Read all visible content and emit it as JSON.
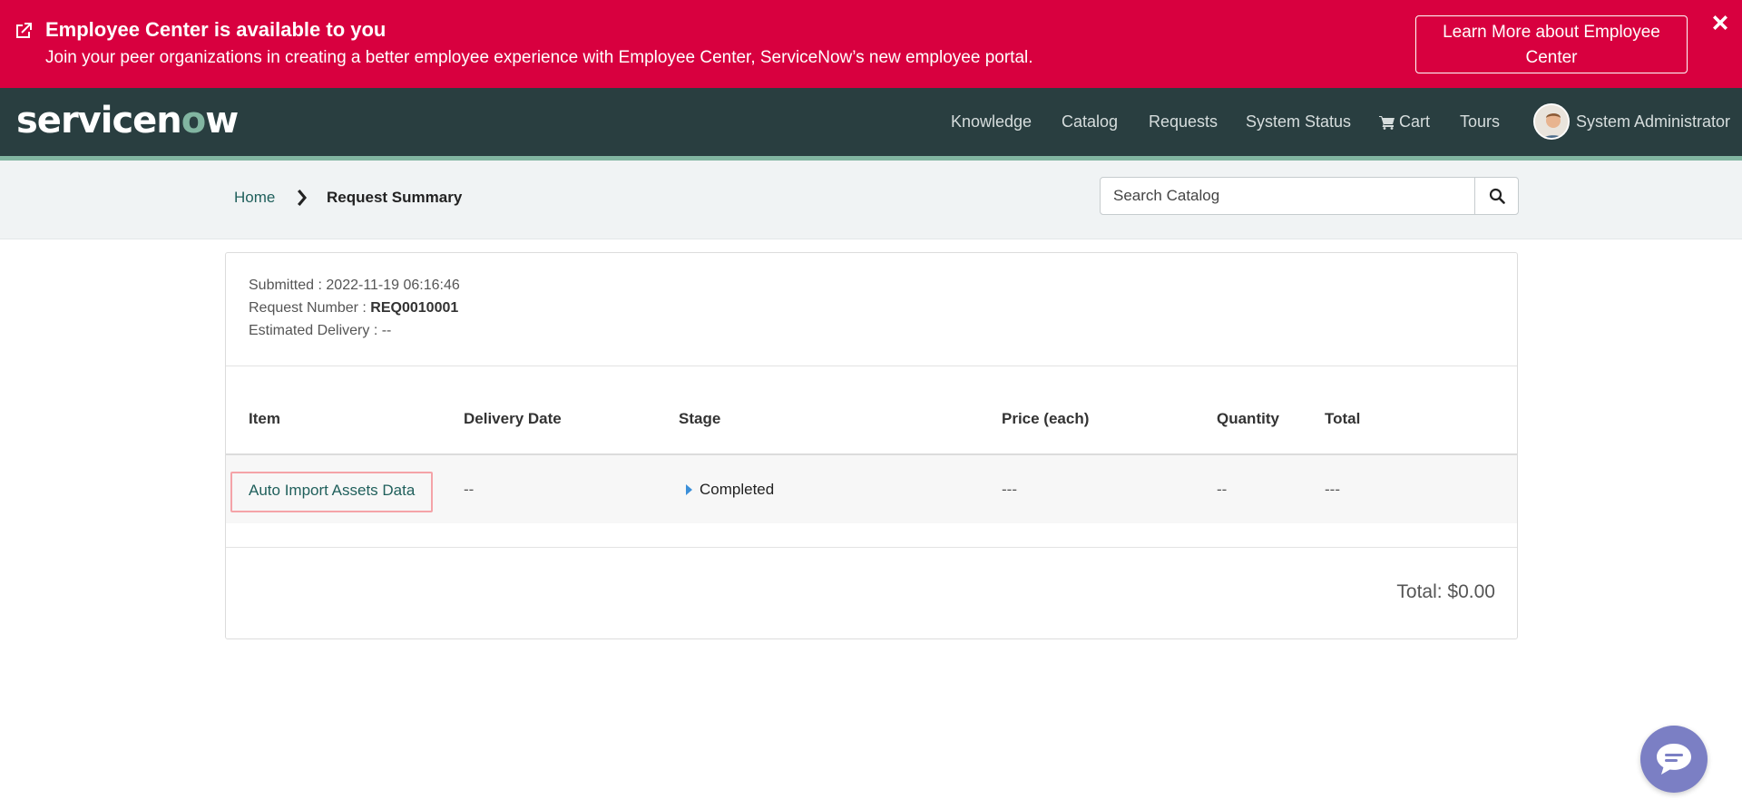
{
  "banner": {
    "title": "Employee Center is available to you",
    "text": "Join your peer organizations in creating a better employee experience with Employee Center, ServiceNow’s new employee portal.",
    "button_label": "Learn More about Employee Center",
    "icon": "external-link-icon",
    "close_icon": "close-icon",
    "color": "#d8003f"
  },
  "header": {
    "logo_text_pre": "servicen",
    "logo_text_o": "o",
    "logo_text_post": "w",
    "nav": {
      "knowledge": "Knowledge",
      "catalog": "Catalog",
      "requests": "Requests",
      "system_status": "System Status",
      "cart": "Cart",
      "tours": "Tours",
      "user": "System Administrator"
    },
    "background": "#293e40",
    "accent": "#81b5a1"
  },
  "breadcrumb": {
    "home": "Home",
    "current": "Request Summary"
  },
  "search": {
    "placeholder": "Search Catalog"
  },
  "summary": {
    "submitted_label": "Submitted :",
    "submitted_value": "2022-11-19 06:16:46",
    "request_number_label": "Request Number :",
    "request_number_value": "REQ0010001",
    "estimated_delivery_label": "Estimated Delivery :",
    "estimated_delivery_value": "--"
  },
  "table": {
    "headers": {
      "item": "Item",
      "delivery_date": "Delivery Date",
      "stage": "Stage",
      "price": "Price (each)",
      "quantity": "Quantity",
      "total": "Total"
    },
    "rows": [
      {
        "item": "Auto Import Assets Data",
        "delivery_date": "--",
        "stage": "Completed",
        "price": "---",
        "quantity": "--",
        "total": "---"
      }
    ]
  },
  "total_text": "Total: $0.00",
  "chat": {
    "icon": "chat-bubble-icon"
  }
}
